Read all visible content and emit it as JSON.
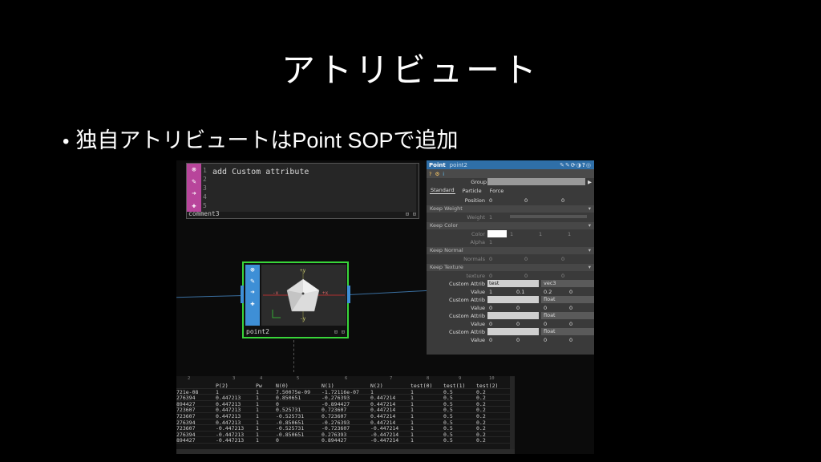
{
  "title": "アトリビュート",
  "bullet": "独自アトリビュートはPoint SOPで追加",
  "comment_node": {
    "name": "comment3",
    "line_numbers": [
      "1",
      "2",
      "3",
      "4",
      "5"
    ],
    "text": "add Custom attribute"
  },
  "point_node": {
    "name": "point2",
    "axis_labels": {
      "top": "+y",
      "bottom": "-y",
      "left": "-x",
      "right": "+x"
    }
  },
  "panel": {
    "op_type": "Point",
    "op_name": "point2",
    "group_label": "Group",
    "tabs": [
      "Standard",
      "Particle",
      "Force"
    ],
    "position": {
      "label": "Position",
      "values": [
        "0",
        "0",
        "0"
      ]
    },
    "keep_weight": "Keep Weight",
    "weight": {
      "label": "Weight",
      "value": "1"
    },
    "keep_color": "Keep Color",
    "color": {
      "label": "Color",
      "values": [
        "1",
        "1",
        "1"
      ],
      "swatch": "#ffffff"
    },
    "alpha": {
      "label": "Alpha",
      "value": "1"
    },
    "keep_normal": "Keep Normal",
    "normals": {
      "label": "Normals",
      "values": [
        "0",
        "0",
        "0"
      ]
    },
    "keep_texture": "Keep Texture",
    "texture": {
      "label": "texture",
      "values": [
        "0",
        "0",
        "0"
      ]
    },
    "custom": [
      {
        "label": "Custom Attrib",
        "name": "test",
        "type": "vec3",
        "value_label": "Value",
        "values": [
          "1",
          "0.1",
          "0.2",
          "0"
        ]
      },
      {
        "label": "Custom Attrib",
        "name": "",
        "type": "float",
        "value_label": "Value",
        "values": [
          "0",
          "0",
          "0",
          "0"
        ]
      },
      {
        "label": "Custom Attrib",
        "name": "",
        "type": "float",
        "value_label": "Value",
        "values": [
          "0",
          "0",
          "0",
          "0"
        ]
      },
      {
        "label": "Custom Attrib",
        "name": "",
        "type": "float",
        "value_label": "Value",
        "values": [
          "0",
          "0",
          "0",
          "0"
        ]
      }
    ]
  },
  "sheet": {
    "col_numbers": [
      "2",
      "3",
      "4",
      "5",
      "6",
      "7",
      "8",
      "9",
      "10"
    ],
    "headers": [
      "P(2)",
      "Pw",
      "N(0)",
      "N(1)",
      "N(2)",
      "test(0)",
      "test(1)",
      "test(2)"
    ],
    "rows": [
      [
        "721e-08",
        "1",
        "1",
        "7.50075e-09",
        "-1.72116e-07",
        "1",
        "1",
        "0.5",
        "0.2"
      ],
      [
        "276394",
        "0.447213",
        "1",
        "0.850651",
        "-0.276393",
        "0.447214",
        "1",
        "0.5",
        "0.2"
      ],
      [
        "894427",
        "0.447213",
        "1",
        "0",
        "-0.894427",
        "0.447214",
        "1",
        "0.5",
        "0.2"
      ],
      [
        "723607",
        "0.447213",
        "1",
        "0.525731",
        "0.723607",
        "0.447214",
        "1",
        "0.5",
        "0.2"
      ],
      [
        "723607",
        "0.447213",
        "1",
        "-0.525731",
        "0.723607",
        "0.447214",
        "1",
        "0.5",
        "0.2"
      ],
      [
        "276394",
        "0.447213",
        "1",
        "-0.850651",
        "-0.276393",
        "0.447214",
        "1",
        "0.5",
        "0.2"
      ],
      [
        "723607",
        "-0.447213",
        "1",
        "-0.525731",
        "-0.723607",
        "-0.447214",
        "1",
        "0.5",
        "0.2"
      ],
      [
        "276394",
        "-0.447213",
        "1",
        "-0.850651",
        "0.276393",
        "-0.447214",
        "1",
        "0.5",
        "0.2"
      ],
      [
        "894427",
        "-0.447213",
        "1",
        "0",
        "0.894427",
        "-0.447214",
        "1",
        "0.5",
        "0.2"
      ]
    ]
  }
}
